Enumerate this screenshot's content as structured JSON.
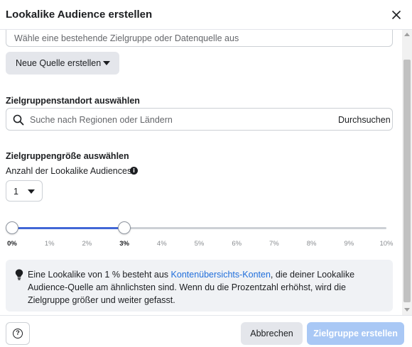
{
  "dialog": {
    "title": "Lookalike Audience erstellen",
    "close_icon": "close-icon"
  },
  "source": {
    "placeholder": "Wähle eine bestehende Zielgruppe oder Datenquelle aus",
    "new_source_label": "Neue Quelle erstellen"
  },
  "location": {
    "section_title": "Zielgruppenstandort auswählen",
    "search_placeholder": "Suche nach Regionen oder Ländern",
    "search_value": "",
    "browse_label": "Durchsuchen"
  },
  "size": {
    "section_title": "Zielgruppengröße auswählen",
    "count_label": "Anzahl der Lookalike Audiences",
    "count_value": "1",
    "slider": {
      "min": 0,
      "max": 10,
      "range_start": 0,
      "range_end": 3,
      "ticks": [
        "0%",
        "1%",
        "2%",
        "3%",
        "4%",
        "5%",
        "6%",
        "7%",
        "8%",
        "9%",
        "10%"
      ]
    }
  },
  "info": {
    "text_before": "Eine Lookalike von 1 % besteht aus ",
    "link": "Kontenübersichts-Konten",
    "text_after": ", die deiner Lookalike Audience-Quelle am ähnlichsten sind. Wenn du die Prozentzahl erhöhst, wird die Zielgruppe größer und weiter gefasst."
  },
  "footer": {
    "cancel_label": "Abbrechen",
    "create_label": "Zielgruppe erstellen"
  },
  "colors": {
    "primary_disabled": "#a9c8f5",
    "slider_fill": "#4267d6",
    "link": "#216fdb"
  }
}
